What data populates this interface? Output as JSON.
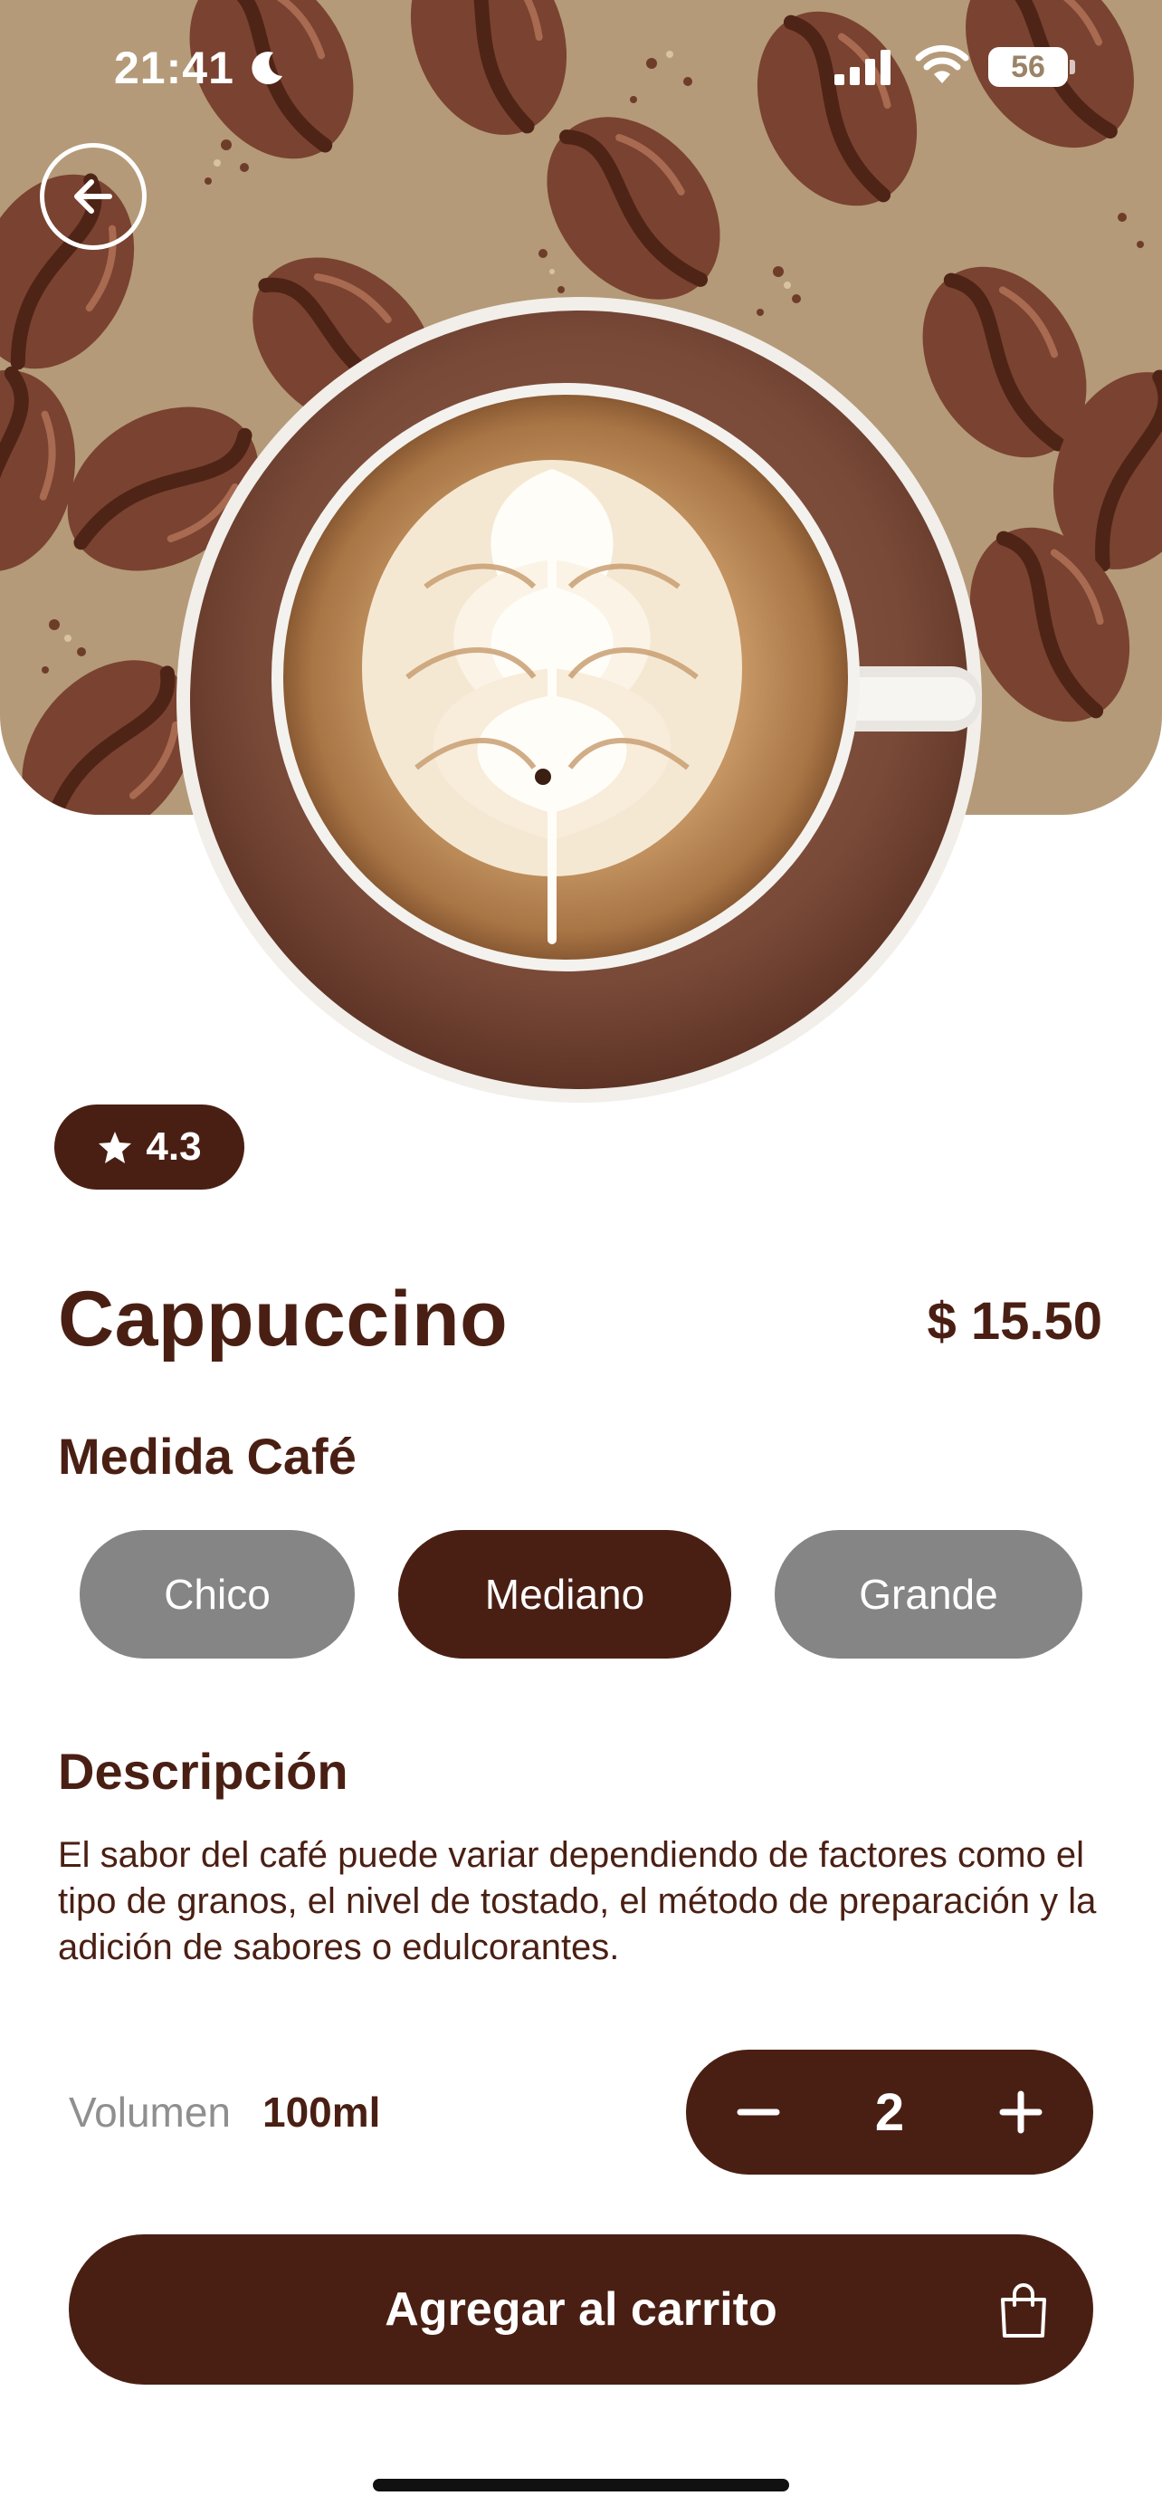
{
  "status_bar": {
    "time": "21:41",
    "battery_level": "56",
    "icons": [
      "moon-icon",
      "signal-icon",
      "wifi-icon",
      "battery-icon"
    ]
  },
  "header": {
    "back_icon": "arrow-left-icon",
    "background": "coffee-bean-pattern",
    "background_color": "#b49a78"
  },
  "product": {
    "image": "cappuccino-cup-latte-art",
    "rating": "4.3",
    "rating_icon": "star-icon",
    "name": "Cappuccino",
    "price": "$ 15.50"
  },
  "size_section": {
    "heading": "Medida Café",
    "options": [
      {
        "label": "Chico",
        "selected": false
      },
      {
        "label": "Mediano",
        "selected": true
      },
      {
        "label": "Grande",
        "selected": false
      }
    ]
  },
  "description_section": {
    "heading": "Descripción",
    "text": "El sabor del café puede variar dependiendo de factores como el tipo de granos, el nivel de tostado, el método de preparación y la adición de sabores o edulcorantes."
  },
  "volume": {
    "label": "Volumen",
    "value": "100ml"
  },
  "quantity": {
    "value": "2",
    "decrement_icon": "minus-icon",
    "increment_icon": "plus-icon"
  },
  "cart_button": {
    "label": "Agregar al carrito",
    "icon": "shopping-bag-icon"
  },
  "colors": {
    "primary": "#4a1f13",
    "inactive_chip": "#858585",
    "muted_text": "#8f8f8f",
    "background": "#ffffff"
  }
}
